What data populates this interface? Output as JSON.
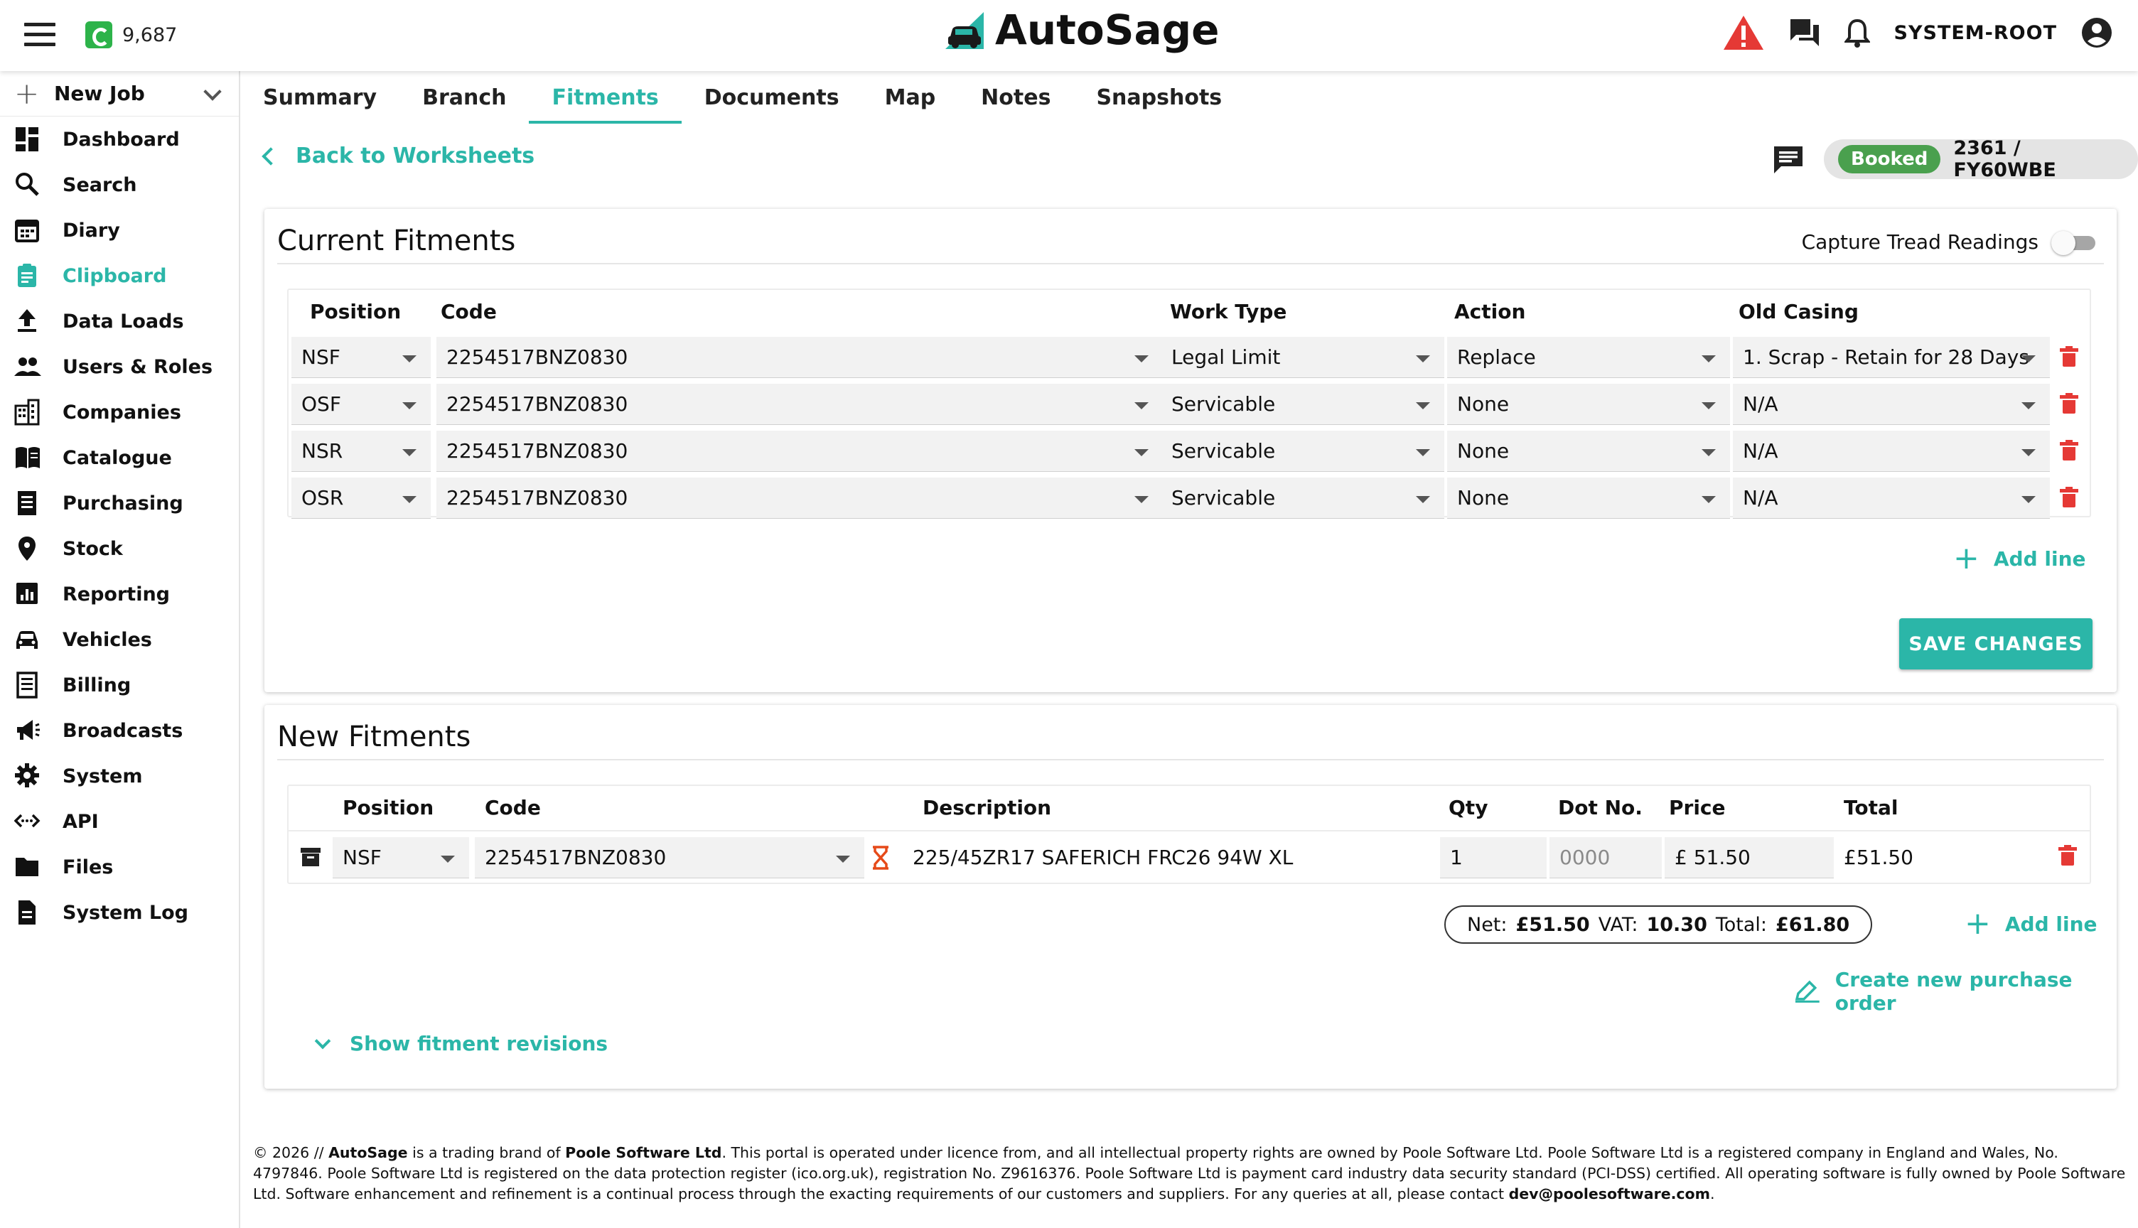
{
  "header": {
    "credit_balance": "9,687",
    "app_name": "AutoSage",
    "username": "SYSTEM-ROOT",
    "icons": [
      "menu-icon",
      "credit-icon",
      "warning-icon",
      "chat-icon",
      "bell-icon",
      "account-icon"
    ],
    "colors": {
      "accent": "#2bb6a8",
      "warning": "#e53935",
      "credit": "#2db34a"
    }
  },
  "sidebar": {
    "new_job": "New Job",
    "items": [
      {
        "label": "Dashboard",
        "icon": "dashboard-icon"
      },
      {
        "label": "Search",
        "icon": "search-icon"
      },
      {
        "label": "Diary",
        "icon": "calendar-icon"
      },
      {
        "label": "Clipboard",
        "icon": "clipboard-icon",
        "active": true
      },
      {
        "label": "Data Loads",
        "icon": "upload-icon"
      },
      {
        "label": "Users & Roles",
        "icon": "people-icon"
      },
      {
        "label": "Companies",
        "icon": "building-icon"
      },
      {
        "label": "Catalogue",
        "icon": "book-icon"
      },
      {
        "label": "Purchasing",
        "icon": "receipt-icon"
      },
      {
        "label": "Stock",
        "icon": "location-pin-icon"
      },
      {
        "label": "Reporting",
        "icon": "chart-icon"
      },
      {
        "label": "Vehicles",
        "icon": "car-icon"
      },
      {
        "label": "Billing",
        "icon": "invoice-icon"
      },
      {
        "label": "Broadcasts",
        "icon": "megaphone-icon"
      },
      {
        "label": "System",
        "icon": "gear-icon"
      },
      {
        "label": "API",
        "icon": "code-icon"
      },
      {
        "label": "Files",
        "icon": "folder-icon"
      },
      {
        "label": "System Log",
        "icon": "document-icon"
      }
    ]
  },
  "tabs": [
    "Summary",
    "Branch",
    "Fitments",
    "Documents",
    "Map",
    "Notes",
    "Snapshots"
  ],
  "active_tab": "Fitments",
  "back_link": "Back to Worksheets",
  "job": {
    "status": "Booked",
    "reference": "2361 / FY60WBE"
  },
  "current_fitments": {
    "title": "Current Fitments",
    "capture_label": "Capture Tread Readings",
    "capture_enabled": false,
    "columns": [
      "Position",
      "Code",
      "Work Type",
      "Action",
      "Old Casing"
    ],
    "rows": [
      {
        "position": "NSF",
        "code": "2254517BNZ0830",
        "work_type": "Legal Limit",
        "action": "Replace",
        "old_casing": "1. Scrap - Retain for 28 Days"
      },
      {
        "position": "OSF",
        "code": "2254517BNZ0830",
        "work_type": "Servicable",
        "action": "None",
        "old_casing": "N/A"
      },
      {
        "position": "NSR",
        "code": "2254517BNZ0830",
        "work_type": "Servicable",
        "action": "None",
        "old_casing": "N/A"
      },
      {
        "position": "OSR",
        "code": "2254517BNZ0830",
        "work_type": "Servicable",
        "action": "None",
        "old_casing": "N/A"
      }
    ],
    "add_line": "Add line",
    "save": "SAVE CHANGES"
  },
  "new_fitments": {
    "title": "New Fitments",
    "columns": [
      "Position",
      "Code",
      "Description",
      "Qty",
      "Dot No.",
      "Price",
      "Total"
    ],
    "rows": [
      {
        "position": "NSF",
        "code": "2254517BNZ0830",
        "description": "225/45ZR17 SAFERICH FRC26 94W XL",
        "qty": "1",
        "dot_placeholder": "0000",
        "price": "£ 51.50",
        "total": "£51.50"
      }
    ],
    "totals": {
      "net_label": "Net:",
      "net": "£51.50",
      "vat_label": "VAT:",
      "vat": "10.30",
      "total_label": "Total:",
      "total": "£61.80"
    },
    "add_line": "Add line",
    "create_po": "Create new purchase order",
    "show_revisions": "Show fitment revisions"
  },
  "footer": {
    "year": "© 2026 //",
    "brand": "AutoSage",
    "text1": "is a trading brand of",
    "company": "Poole Software Ltd",
    "text2": ". This portal is operated under licence from, and all intellectual property rights are owned by Poole Software Ltd. Poole Software Ltd is a registered company in England and Wales, No. 4797846. Poole Software Ltd is registered on the data protection register (ico.org.uk), registration No. Z9616376. Poole Software Ltd is payment card industry data security standard (PCI-DSS) certified. All operating software is fully owned by Poole Software Ltd. Software enhancement and refinement is a continual process through the exacting requirements of our customers and suppliers. For any queries at all, please contact",
    "email": "dev@poolesoftware.com",
    "end": "."
  }
}
